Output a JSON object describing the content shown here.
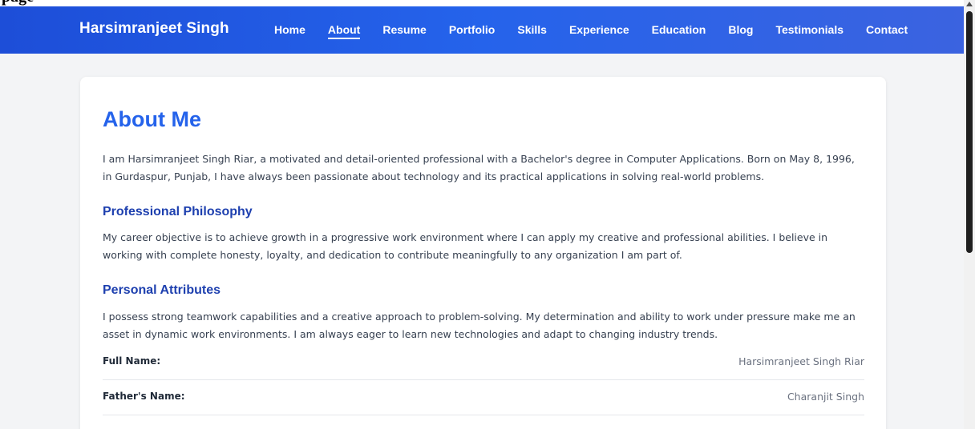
{
  "page_caption": "page",
  "header": {
    "brand": "Harsimranjeet Singh",
    "nav": [
      {
        "label": "Home",
        "active": false
      },
      {
        "label": "About",
        "active": true
      },
      {
        "label": "Resume",
        "active": false
      },
      {
        "label": "Portfolio",
        "active": false
      },
      {
        "label": "Skills",
        "active": false
      },
      {
        "label": "Experience",
        "active": false
      },
      {
        "label": "Education",
        "active": false
      },
      {
        "label": "Blog",
        "active": false
      },
      {
        "label": "Testimonials",
        "active": false
      },
      {
        "label": "Contact",
        "active": false
      }
    ]
  },
  "about": {
    "title": "About Me",
    "intro": "I am Harsimranjeet Singh Riar, a motivated and detail-oriented professional with a Bachelor's degree in Computer Applications. Born on May 8, 1996, in Gurdaspur, Punjab, I have always been passionate about technology and its practical applications in solving real-world problems.",
    "philosophy_title": "Professional Philosophy",
    "philosophy_text": "My career objective is to achieve growth in a progressive work environment where I can apply my creative and professional abilities. I believe in working with complete honesty, loyalty, and dedication to contribute meaningfully to any organization I am part of.",
    "attributes_title": "Personal Attributes",
    "attributes_text": "I possess strong teamwork capabilities and a creative approach to problem-solving. My determination and ability to work under pressure make me an asset in dynamic work environments. I am always eager to learn new technologies and adapt to changing industry trends.",
    "info": [
      {
        "label": "Full Name:",
        "value": "Harsimranjeet Singh Riar"
      },
      {
        "label": "Father's Name:",
        "value": "Charanjit Singh"
      }
    ]
  },
  "colors": {
    "nav_gradient_start": "#1d4ed8",
    "nav_gradient_end": "#3b63e0",
    "title": "#2563eb",
    "subtitle": "#1e40af"
  }
}
